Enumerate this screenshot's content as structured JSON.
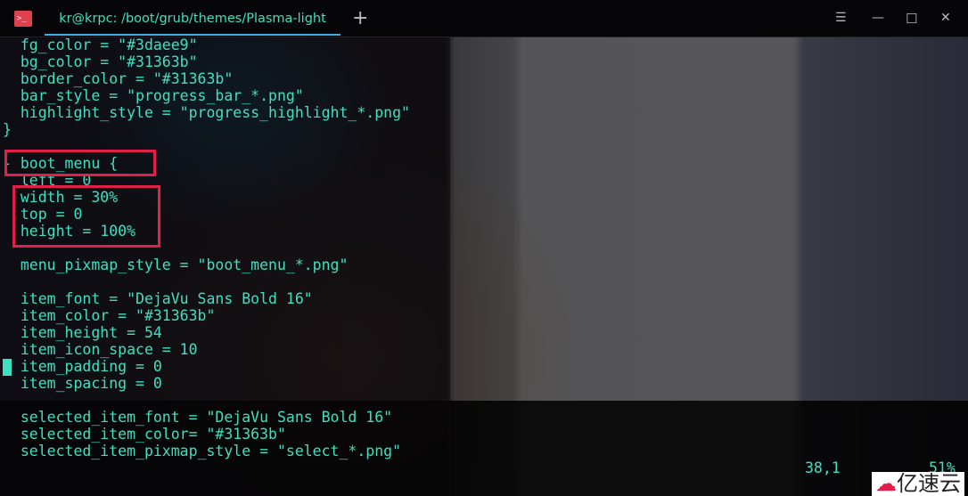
{
  "window": {
    "title": "kr@krpc: /boot/grub/themes/Plasma-light",
    "new_tab": "+",
    "menu": "☰",
    "minimize": "—",
    "maximize": "☐",
    "close": "✕"
  },
  "editor": {
    "lines": [
      "  fg_color = \"#3daee9\"",
      "  bg_color = \"#31363b\"",
      "  border_color = \"#31363b\"",
      "  bar_style = \"progress_bar_*.png\"",
      "  highlight_style = \"progress_highlight_*.png\"",
      "}",
      "",
      "- boot_menu {",
      "  left = 0",
      "  width = 30%",
      "  top = 0",
      "  height = 100%",
      "",
      "  menu_pixmap_style = \"boot_menu_*.png\"",
      "",
      "  item_font = \"DejaVu Sans Bold 16\"",
      "  item_color = \"#31363b\"",
      "  item_height = 54",
      "  item_icon_space = 10",
      "  item_padding = 0",
      "  item_spacing = 0",
      "",
      "  selected_item_font = \"DejaVu Sans Bold 16\"",
      "  selected_item_color= \"#31363b\"",
      "  selected_item_pixmap_style = \"select_*.png\""
    ]
  },
  "status": {
    "position": "38,1",
    "percent": "51%"
  },
  "watermark": "亿速云",
  "colors": {
    "text": "#3de0c0",
    "accent": "#3daee9",
    "highlight_box": "#e0204a"
  }
}
